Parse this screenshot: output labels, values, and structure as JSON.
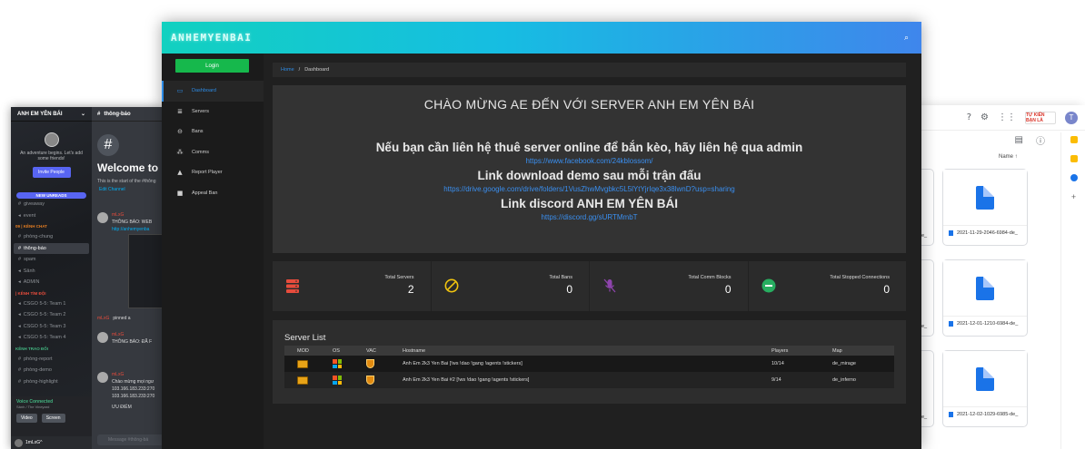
{
  "panel": {
    "brand": "ANHEMYENBAI",
    "login_label": "Login",
    "nav": [
      {
        "label": "Dashboard",
        "icon": "monitor-icon"
      },
      {
        "label": "Servers",
        "icon": "server-list-icon"
      },
      {
        "label": "Bans",
        "icon": "ban-icon"
      },
      {
        "label": "Comms",
        "icon": "comms-icon"
      },
      {
        "label": "Report Player",
        "icon": "report-icon"
      },
      {
        "label": "Appeal Ban",
        "icon": "lock-icon"
      }
    ],
    "breadcrumb": {
      "home": "Home",
      "separator": "/",
      "current": "Dashboard"
    },
    "welcome": {
      "title": "CHÀO MỪNG AE ĐẾN VỚI SERVER ANH EM YÊN BÁI",
      "contact_heading": "Nếu bạn cần liên hệ thuê server online để bắn kèo, hãy liên hệ qua admin",
      "contact_link": "https://www.facebook.com/24kblossom/",
      "download_heading": "Link download demo sau mỗi trận đấu",
      "download_link": "https://drive.google.com/drive/folders/1VusZhwMvgbkc5L5lYtYjrIqe3x38lwnD?usp=sharing",
      "discord_heading": "Link discord ANH EM YÊN BÁI",
      "discord_link": "https://discord.gg/sURTMmbT"
    },
    "stats": [
      {
        "label": "Total Servers",
        "value": "2",
        "icon": "server-icon",
        "color": "#e74c3c"
      },
      {
        "label": "Total Bans",
        "value": "0",
        "icon": "ban-circle-icon",
        "color": "#f1c40f"
      },
      {
        "label": "Total Comm Blocks",
        "value": "0",
        "icon": "mic-off-icon",
        "color": "#8e44ad"
      },
      {
        "label": "Total Stopped Connections",
        "value": "0",
        "icon": "stop-connection-icon",
        "color": "#27ae60"
      }
    ],
    "server_list": {
      "title": "Server List",
      "columns": [
        "MOD",
        "OS",
        "VAC",
        "Hostname",
        "Players",
        "Map"
      ],
      "rows": [
        {
          "hostname": "Anh Em 2k3 Yen Bai [!ws !dao !gang !agents !stickers]",
          "players": "10/14",
          "map": "de_mirage"
        },
        {
          "hostname": "Anh Em 2k3 Yen Bai #2 [!ws !dao !gang !agents !stickers]",
          "players": "9/14",
          "map": "de_inferno"
        }
      ]
    }
  },
  "discord": {
    "server_name": "ANH EM YÊN BÁI",
    "popup_text": "An adventure begins. Let's add some friends!",
    "invite_label": "Invite People",
    "new_unreads": "NEW UNREADS",
    "channels_top": [
      "giveaway",
      "event"
    ],
    "cat_chat": "09 | KÊNH CHAT",
    "chat_channels": [
      "phòng-chung",
      "thông-báo",
      "spam",
      "Sảnh",
      "ADMIN"
    ],
    "cat_team": "| KÊNH TÌM ĐỘI",
    "team_channels": [
      "CSGO 5-5: Team 1",
      "CSGO 5-5: Team 2",
      "CSGO 5-5: Team 3",
      "CSGO 5-5: Team 4"
    ],
    "cat_report": "KÊNH TRAO ĐỔI",
    "report_channels": [
      "phòng-report",
      "phòng-demo",
      "phòng-highlight"
    ],
    "voice_connected": "Voice Connected",
    "voice_sub": "Sảnh / The Vineyard",
    "video_label": "Video",
    "screen_label": "Screen",
    "username": "1mLxG^",
    "channel_header": "thông-báo",
    "welcome": "Welcome to",
    "start_text": "This is the start of the #thông",
    "edit_channel": "Edit Channel",
    "msg1_author": "mLxG",
    "msg1_text": "THÔNG BÁO: WEB",
    "msg1_link": "http://anhemyenba",
    "msg2_author": "mLxG",
    "msg2_text": "pinned a",
    "msg3_author": "mLxG",
    "msg3_text": "THÔNG BÁO: ĐÃ F",
    "msg4_author": "mLxG",
    "msg4_text": "Chào mừng mọi ngư",
    "ip1": "103.166.183.233:270",
    "ip2": "103.166.183.233:270",
    "msg_tail": "ƯU ĐIỂM",
    "input_placeholder": "Message #thông-bá"
  },
  "gdrive": {
    "sort_label": "Name ↑",
    "files": [
      "2021-11-29-2046-6984-de_",
      "2021-12-01-1210-6984-de_",
      "2021-12-02-1029-6985-de_"
    ],
    "left_caps": [
      "e_",
      "e_",
      "e_"
    ],
    "avatar": "T",
    "logo_text": "TỰ KIẾN BẠN LÀ"
  }
}
